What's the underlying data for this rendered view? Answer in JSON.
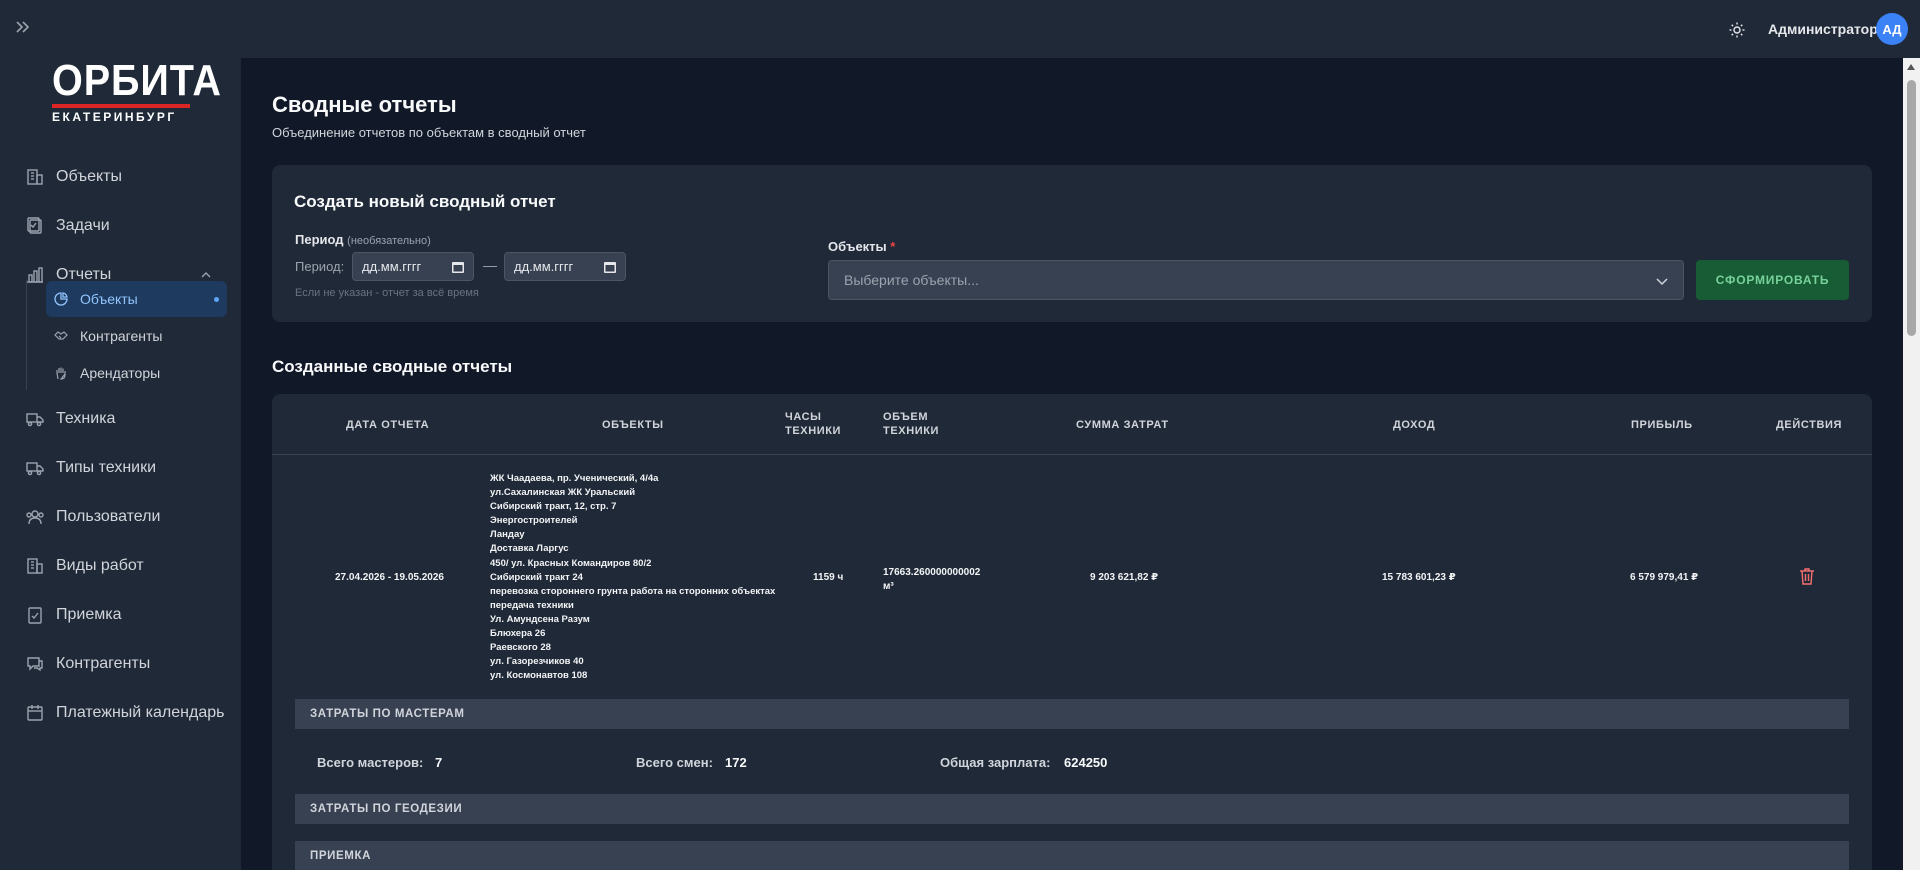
{
  "topbar": {
    "user_name": "Администратор",
    "avatar_initials": "АД"
  },
  "sidebar": {
    "logo_main": "ОРБИТА",
    "logo_sub": "ЕКАТЕРИНБУРГ",
    "items": [
      {
        "label": "Объекты",
        "icon": "building-icon"
      },
      {
        "label": "Задачи",
        "icon": "clipboard-icon"
      },
      {
        "label": "Отчеты",
        "icon": "bar-chart-icon"
      },
      {
        "label": "Техника",
        "icon": "truck-icon"
      },
      {
        "label": "Типы техники",
        "icon": "truck-icon"
      },
      {
        "label": "Пользователи",
        "icon": "users-icon"
      },
      {
        "label": "Виды работ",
        "icon": "building-icon"
      },
      {
        "label": "Приемка",
        "icon": "clipboard-check-icon"
      },
      {
        "label": "Контрагенты",
        "icon": "chat-icon"
      },
      {
        "label": "Платежный календарь",
        "icon": "calendar-icon"
      }
    ],
    "report_subitems": [
      {
        "label": "Объекты",
        "icon": "pie-chart-icon",
        "active": true
      },
      {
        "label": "Контрагенты",
        "icon": "handshake-icon",
        "active": false
      },
      {
        "label": "Арендаторы",
        "icon": "hand-icon",
        "active": false
      }
    ]
  },
  "page": {
    "title": "Сводные отчеты",
    "subtitle": "Объединение отчетов по объектам в сводный отчет"
  },
  "create": {
    "title": "Создать новый сводный отчет",
    "period_label": "Период",
    "period_optional": "(необязательно)",
    "period_prefix": "Период:",
    "date_from_placeholder": "дд.мм.гггг",
    "date_to_placeholder": "дд.мм.гггг",
    "dash": "—",
    "period_hint": "Если не указан - отчет за всё время",
    "objects_label": "Объекты",
    "objects_required": "*",
    "objects_placeholder": "Выберите объекты...",
    "submit_label": "СФОРМИРОВАТЬ"
  },
  "created": {
    "title": "Созданные сводные отчеты",
    "headers": {
      "date": "Дата отчета",
      "objects": "Объекты",
      "hours_1": "Часы",
      "hours_2": "техники",
      "volume_1": "Объем",
      "volume_2": "техники",
      "costs": "Сумма затрат",
      "income": "Доход",
      "profit": "Прибыль",
      "actions": "Действия"
    },
    "row": {
      "date": "27.04.2026 - 19.05.2026",
      "objects": [
        "ЖК Чаадаева, пр. Ученический, 4/4а",
        "ул.Сахалинская ЖК Уральский",
        "Сибирский тракт, 12, стр. 7",
        "Энергостроителей",
        "Ландау",
        "Доставка Ларгус",
        "450/ ул. Красных Командиров 80/2",
        "Сибирский тракт 24",
        "перевозка стороннего грунта работа на сторонних объектах",
        "передача техники",
        "Ул. Амундсена Разум",
        "Блюхера 26",
        "Раевского 28",
        "ул. Газорезчиков 40",
        "ул. Космонавтов 108"
      ],
      "hours": "1159 ч",
      "volume": "17663.260000000002",
      "volume_unit": "м³",
      "costs": "9 203 621,82 ₽",
      "income": "15 783 601,23 ₽",
      "profit": "6 579 979,41 ₽"
    },
    "masters": {
      "section_title": "ЗАТРАТЫ ПО МАСТЕРАМ",
      "total_masters_label": "Всего мастеров:",
      "total_masters_value": "7",
      "total_shifts_label": "Всего смен:",
      "total_shifts_value": "172",
      "total_salary_label": "Общая зарплата:",
      "total_salary_value": "624250"
    },
    "geodesy_title": "ЗАТРАТЫ ПО ГЕОДЕЗИИ",
    "acceptance_title": "ПРИЕМКА"
  }
}
